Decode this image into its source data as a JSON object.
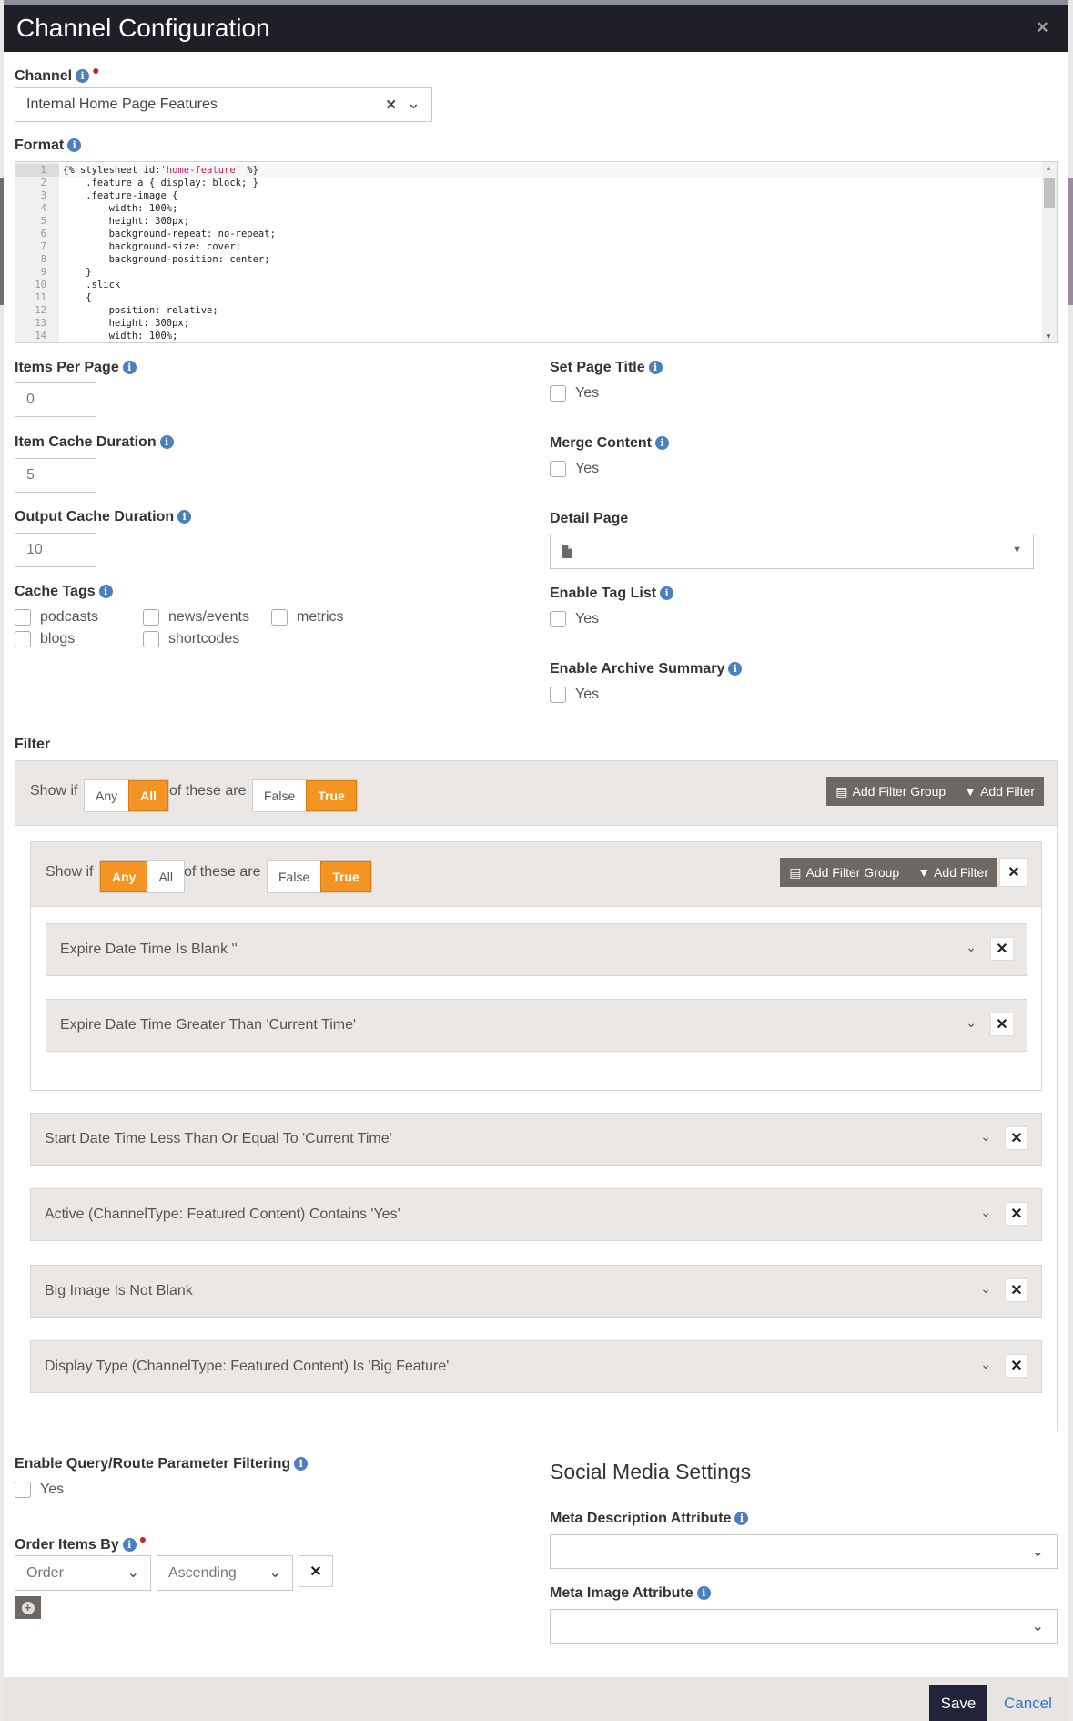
{
  "modal": {
    "title": "Channel Configuration",
    "close_icon": "×"
  },
  "channel": {
    "label": "Channel",
    "required": true,
    "value": "Internal Home Page Features",
    "clear_icon": "✕",
    "chevron_icon": "⌄"
  },
  "format": {
    "label": "Format",
    "code_lines": [
      {
        "n": "1",
        "text": "{% stylesheet id:'home-feature' %}"
      },
      {
        "n": "2",
        "text": "    .feature a { display: block; }"
      },
      {
        "n": "3",
        "text": "    .feature-image {"
      },
      {
        "n": "4",
        "text": "        width: 100%;"
      },
      {
        "n": "5",
        "text": "        height: 300px;"
      },
      {
        "n": "6",
        "text": "        background-repeat: no-repeat;"
      },
      {
        "n": "7",
        "text": "        background-size: cover;"
      },
      {
        "n": "8",
        "text": "        background-position: center;"
      },
      {
        "n": "9",
        "text": "    }"
      },
      {
        "n": "10",
        "text": "    .slick"
      },
      {
        "n": "11",
        "text": "    {"
      },
      {
        "n": "12",
        "text": "        position: relative;"
      },
      {
        "n": "13",
        "text": "        height: 300px;"
      },
      {
        "n": "14",
        "text": "        width: 100%;"
      }
    ]
  },
  "left_fields": {
    "items_per_page": {
      "label": "Items Per Page",
      "value": "0"
    },
    "item_cache_duration": {
      "label": "Item Cache Duration",
      "value": "5"
    },
    "output_cache_duration": {
      "label": "Output Cache Duration",
      "value": "10"
    },
    "cache_tags": {
      "label": "Cache Tags",
      "options": [
        {
          "label": "podcasts",
          "checked": false
        },
        {
          "label": "news/events",
          "checked": false
        },
        {
          "label": "metrics",
          "checked": false
        },
        {
          "label": "blogs",
          "checked": false
        },
        {
          "label": "shortcodes",
          "checked": false
        }
      ]
    }
  },
  "right_fields": {
    "set_page_title": {
      "label": "Set Page Title",
      "option": "Yes",
      "checked": false
    },
    "merge_content": {
      "label": "Merge Content",
      "option": "Yes",
      "checked": false
    },
    "detail_page": {
      "label": "Detail Page",
      "value": "",
      "icon": "file-icon"
    },
    "enable_tag_list": {
      "label": "Enable Tag List",
      "option": "Yes",
      "checked": false
    },
    "enable_archive_summary": {
      "label": "Enable Archive Summary",
      "option": "Yes",
      "checked": false
    }
  },
  "filter": {
    "label": "Filter",
    "show_if": "Show if",
    "of_these_are": "of these are",
    "any": "Any",
    "all": "All",
    "false": "False",
    "true": "True",
    "add_filter_group": "Add Filter Group",
    "add_filter": "Add Filter",
    "outer_group": {
      "mode": "All",
      "truth": "True"
    },
    "inner_group": {
      "mode": "Any",
      "truth": "True",
      "rules": [
        "Expire Date Time Is Blank ''",
        "Expire Date Time Greater Than 'Current Time'"
      ]
    },
    "outer_rules": [
      "Start Date Time Less Than Or Equal To 'Current Time'",
      "Active (ChannelType: Featured Content) Contains 'Yes'",
      "Big Image Is Not Blank",
      "Display Type (ChannelType: Featured Content) Is 'Big Feature'"
    ]
  },
  "query_filtering": {
    "label": "Enable Query/Route Parameter Filtering",
    "option": "Yes",
    "checked": false
  },
  "order_items_by": {
    "label": "Order Items By",
    "required": true,
    "field": "Order",
    "direction": "Ascending"
  },
  "social": {
    "title": "Social Media Settings",
    "meta_description": {
      "label": "Meta Description Attribute",
      "value": ""
    },
    "meta_image": {
      "label": "Meta Image Attribute",
      "value": ""
    }
  },
  "footer": {
    "save": "Save",
    "cancel": "Cancel"
  },
  "colors": {
    "header_bg": "#1f1f28",
    "accent_orange": "#f39423",
    "info_blue": "#4a7fc0",
    "filter_bg": "#ebe7e4",
    "button_dark": "#6e6863",
    "link_blue": "#2a78c6"
  }
}
